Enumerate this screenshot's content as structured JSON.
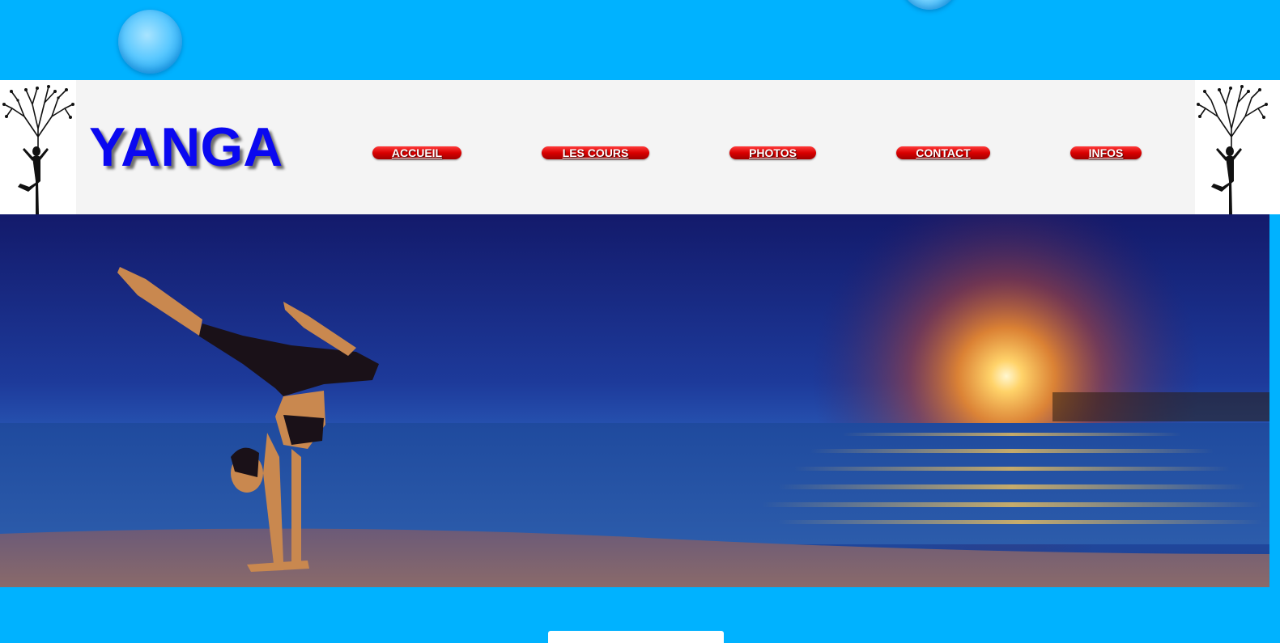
{
  "site": {
    "logo": "YANGA"
  },
  "nav": {
    "items": [
      {
        "label": "ACCUEIL"
      },
      {
        "label": "LES COURS"
      },
      {
        "label": "PHOTOS"
      },
      {
        "label": "CONTACT"
      },
      {
        "label": "INFOS"
      }
    ]
  },
  "colors": {
    "background": "#00b2ff",
    "header": "#f4f4f4",
    "logo": "#0a08f0",
    "nav_button": "#d80000"
  },
  "icons": {
    "tree_left": "yoga-tree-icon",
    "tree_right": "yoga-tree-icon",
    "hero": "yoga-handstand-sunset-image"
  }
}
